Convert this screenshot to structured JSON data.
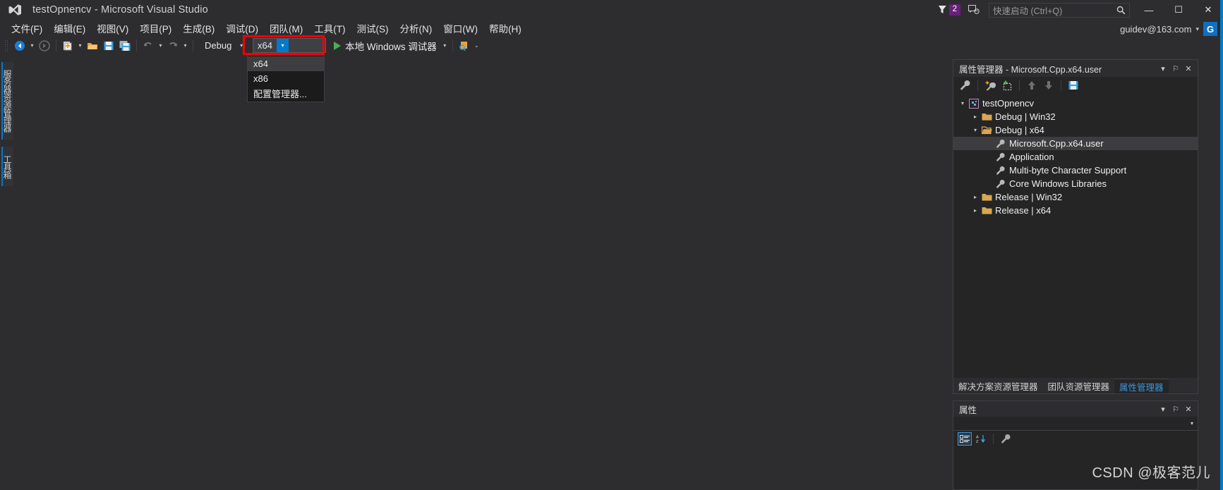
{
  "titlebar": {
    "app_title": "testOpnencv - Microsoft Visual Studio",
    "logo_icon": "visual-studio-logo-icon",
    "notifications": {
      "icon": "notification-flag-icon",
      "count": "2"
    },
    "feedback_icon": "feedback-smiley-icon",
    "quick_launch": {
      "placeholder": "快速启动 (Ctrl+Q)",
      "value": "",
      "icon": "search-icon"
    },
    "window_controls": {
      "minimize": "—",
      "maximize": "☐",
      "close": "✕"
    },
    "account": {
      "email": "guidev@163.com",
      "caret": "▾",
      "avatar_letter": "G",
      "avatar_color": "#0e70c0"
    }
  },
  "menubar": {
    "items": [
      {
        "label": "文件(F)"
      },
      {
        "label": "编辑(E)"
      },
      {
        "label": "视图(V)"
      },
      {
        "label": "项目(P)"
      },
      {
        "label": "生成(B)"
      },
      {
        "label": "调试(D)"
      },
      {
        "label": "团队(M)"
      },
      {
        "label": "工具(T)"
      },
      {
        "label": "测试(S)"
      },
      {
        "label": "分析(N)"
      },
      {
        "label": "窗口(W)"
      },
      {
        "label": "帮助(H)"
      }
    ]
  },
  "toolbar": {
    "nav_back_icon": "navigate-back-icon",
    "nav_forward_icon": "navigate-forward-icon",
    "new_project_icon": "new-project-icon",
    "open_file_icon": "open-file-icon",
    "save_icon": "save-icon",
    "save_all_icon": "save-all-icon",
    "undo_icon": "undo-icon",
    "redo_icon": "redo-icon",
    "config_combo": {
      "value": "Debug",
      "arrow": "▾"
    },
    "platform_combo": {
      "value": "x64",
      "arrow": "▾"
    },
    "run_button": {
      "label": "本地 Windows 调试器",
      "icon": "play-icon",
      "caret": "▾"
    },
    "extra_icon": "attach-to-process-icon",
    "overflow_icon": "toolbar-overflow-icon"
  },
  "platform_dropdown": {
    "options": [
      {
        "label": "x64",
        "selected": true
      },
      {
        "label": "x86",
        "selected": false
      },
      {
        "label": "配置管理器...",
        "selected": false
      }
    ]
  },
  "annotation": {
    "highlight_color": "#f40000",
    "arrow_name": "red-up-arrow-annotation",
    "rect_name": "red-highlight-rectangle"
  },
  "left_tabs": [
    {
      "label": "服务器资源管理器"
    },
    {
      "label": "工具箱"
    }
  ],
  "property_manager": {
    "title": "属性管理器 - Microsoft.Cpp.x64.user",
    "header_buttons": {
      "dropdown": "▾",
      "pin": "⚐",
      "close": "✕"
    },
    "toolbar_icons": [
      "properties-wrench-icon",
      "add-new-project-property-sheet-icon",
      "add-existing-property-sheet-icon",
      "move-up-icon",
      "move-down-icon",
      "save-icon"
    ],
    "tree": [
      {
        "depth": 0,
        "twisty": "▾",
        "icon": "project-icon",
        "label": "testOpnencv",
        "selected": false
      },
      {
        "depth": 1,
        "twisty": "▸",
        "icon": "folder-closed-icon",
        "label": "Debug | Win32",
        "selected": false
      },
      {
        "depth": 1,
        "twisty": "▾",
        "icon": "folder-open-icon",
        "label": "Debug | x64",
        "selected": false
      },
      {
        "depth": 2,
        "twisty": "",
        "icon": "property-sheet-icon",
        "label": "Microsoft.Cpp.x64.user",
        "selected": true
      },
      {
        "depth": 2,
        "twisty": "",
        "icon": "property-sheet-icon",
        "label": "Application",
        "selected": false
      },
      {
        "depth": 2,
        "twisty": "",
        "icon": "property-sheet-icon",
        "label": "Multi-byte Character Support",
        "selected": false
      },
      {
        "depth": 2,
        "twisty": "",
        "icon": "property-sheet-icon",
        "label": "Core Windows Libraries",
        "selected": false
      },
      {
        "depth": 1,
        "twisty": "▸",
        "icon": "folder-closed-icon",
        "label": "Release | Win32",
        "selected": false
      },
      {
        "depth": 1,
        "twisty": "▸",
        "icon": "folder-closed-icon",
        "label": "Release | x64",
        "selected": false
      }
    ],
    "tabs": [
      {
        "label": "解决方案资源管理器",
        "active": false
      },
      {
        "label": "团队资源管理器",
        "active": false
      },
      {
        "label": "属性管理器",
        "active": true
      }
    ],
    "active_tab_color": "#3a96dd"
  },
  "properties_panel": {
    "title": "属性",
    "header_buttons": {
      "dropdown": "▾",
      "pin": "⚐",
      "close": "✕"
    },
    "selector_value": "",
    "selector_arrow": "▾",
    "toolbar_icons": [
      "categorized-view-icon",
      "alphabetical-sort-icon",
      "property-pages-wrench-icon"
    ]
  },
  "watermark": {
    "text": "CSDN @极客范儿"
  }
}
